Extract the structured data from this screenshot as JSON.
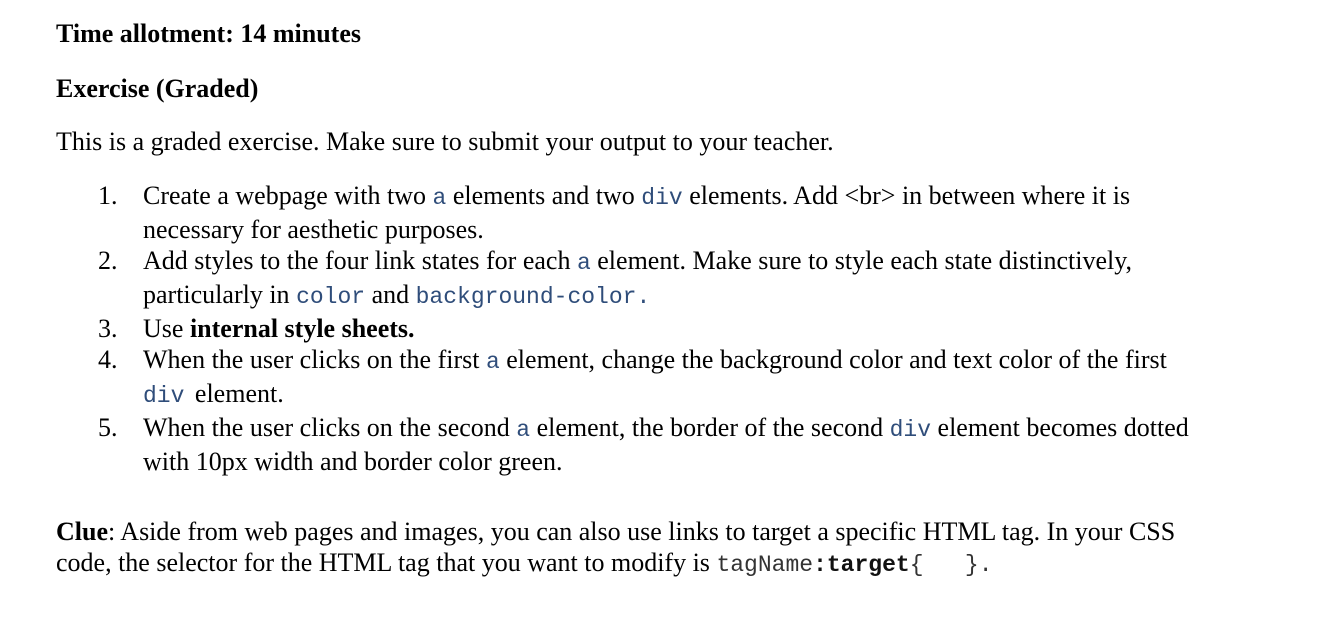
{
  "header": {
    "time_allotment": "Time allotment: 14 minutes",
    "exercise_title": "Exercise (Graded)",
    "intro": "This is a graded exercise. Make sure to submit your output to your teacher."
  },
  "items": [
    {
      "number": "1.",
      "line1_a": "Create a webpage with two ",
      "line1_code1": "a",
      "line1_b": " elements and two ",
      "line1_code2": "div",
      "line1_c": " elements. Add <br> in between where it is",
      "line2": "necessary for aesthetic purposes."
    },
    {
      "number": "2.",
      "line1_a": "Add styles to the four link states for each ",
      "line1_code1": "a",
      "line1_b": " element. Make sure to style each state distinctively,",
      "line2_a": "particularly in ",
      "line2_code1": "color",
      "line2_b": " and ",
      "line2_code2": "background-color",
      "line2_c": "."
    },
    {
      "number": "3.",
      "text_a": "Use ",
      "text_bold": "internal style sheets."
    },
    {
      "number": "4.",
      "line1_a": "When the user clicks on the first ",
      "line1_code1": "a",
      "line1_b": " element, change the background color and text color of the first",
      "line2_code1": "div",
      "line2_a": " element."
    },
    {
      "number": "5.",
      "line1_a": "When the user clicks on the second ",
      "line1_code1": "a",
      "line1_b": " element, the border of the second ",
      "line1_code2": "div",
      "line1_c": " element becomes dotted",
      "line2": "with 10px width and border color green."
    }
  ],
  "clue": {
    "label": "Clue",
    "line1_rest": ": Aside from web pages and images, you can also use links to target a specific HTML tag. In your CSS",
    "line2_a": "code, the selector for the HTML tag that you want to modify is ",
    "code_tagname": "tagName",
    "code_target": ":target",
    "code_braces": "{   }",
    "period": "."
  }
}
